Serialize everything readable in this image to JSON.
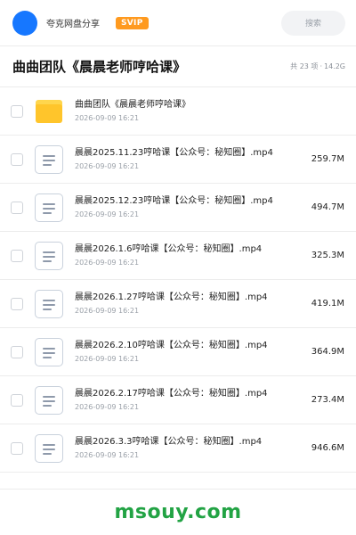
{
  "header": {
    "brand": "夸克网盘分享",
    "badge": "SVIP",
    "search_placeholder": "搜索"
  },
  "folder": {
    "title": "曲曲团队《晨晨老师哼哈课》",
    "count": "共 23 项",
    "separator": "·",
    "total_size": "14.2G"
  },
  "files": [
    {
      "name": "曲曲团队《晨晨老师哼哈课》",
      "date": "2026-09-09 16:21",
      "size": ""
    },
    {
      "name": "晨晨2025.11.23哼哈课【公众号：秘知圈】.mp4",
      "date": "2026-09-09 16:21",
      "size": "259.7M"
    },
    {
      "name": "晨晨2025.12.23哼哈课【公众号：秘知圈】.mp4",
      "date": "2026-09-09 16:21",
      "size": "494.7M"
    },
    {
      "name": "晨晨2026.1.6哼哈课【公众号：秘知圈】.mp4",
      "date": "2026-09-09 16:21",
      "size": "325.3M"
    },
    {
      "name": "晨晨2026.1.27哼哈课【公众号：秘知圈】.mp4",
      "date": "2026-09-09 16:21",
      "size": "419.1M"
    },
    {
      "name": "晨晨2026.2.10哼哈课【公众号：秘知圈】.mp4",
      "date": "2026-09-09 16:21",
      "size": "364.9M"
    },
    {
      "name": "晨晨2026.2.17哼哈课【公众号：秘知圈】.mp4",
      "date": "2026-09-09 16:21",
      "size": "273.4M"
    },
    {
      "name": "晨晨2026.3.3哼哈课【公众号：秘知圈】.mp4",
      "date": "2026-09-09 16:21",
      "size": "946.6M"
    }
  ],
  "icons": {
    "folder": "folder-icon",
    "file": "document-icon",
    "avatar": "avatar"
  },
  "colors": {
    "accent": "#1677ff",
    "badge": "#ff9a1f",
    "folder": "#ffc52b",
    "watermark": "#22a344"
  },
  "watermark": "msouy.com"
}
